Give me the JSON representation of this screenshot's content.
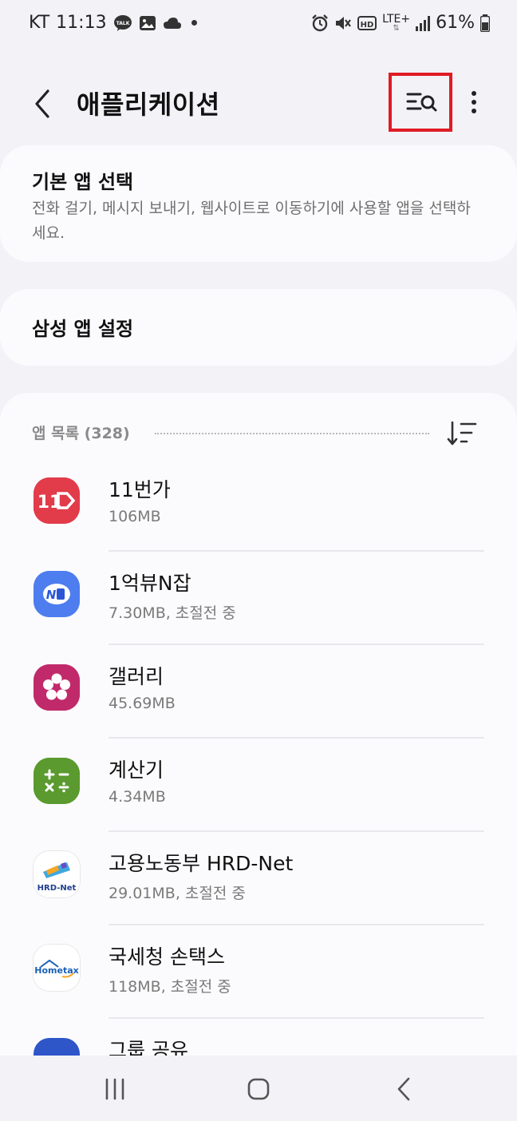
{
  "status": {
    "carrier": "KT",
    "time": "11:13",
    "talk_badge": "TALK",
    "hd_badge": "HD",
    "network": "LTE+",
    "battery": "61%"
  },
  "appbar": {
    "title": "애플리케이션"
  },
  "default_apps": {
    "title": "기본 앱 선택",
    "subtitle": "전화 걸기, 메시지 보내기, 웹사이트로 이동하기에 사용할 앱을 선택하세요."
  },
  "samsung_settings": {
    "title": "삼성 앱 설정"
  },
  "app_list": {
    "header": "앱 목록 (328)",
    "items": [
      {
        "name": "11번가",
        "size": "106MB",
        "icon": "eleven-street-icon",
        "color": "#e8363f",
        "glyph": "11▷"
      },
      {
        "name": "1억뷰N잡",
        "size": "7.30MB, 초절전 중",
        "icon": "one-billion-view-icon",
        "color": "#4e7ef0",
        "glyph": "N잡"
      },
      {
        "name": "갤러리",
        "size": "45.69MB",
        "icon": "gallery-flower-icon",
        "color": "#c4286a",
        "glyph": "✿"
      },
      {
        "name": "계산기",
        "size": "4.34MB",
        "icon": "calculator-icon",
        "color": "#5a9a2e",
        "glyph": "+−×÷"
      },
      {
        "name": "고용노동부 HRD-Net",
        "size": "29.01MB, 초절전 중",
        "icon": "hrd-net-icon",
        "color": "#ffffff",
        "glyph": "HRD-Net"
      },
      {
        "name": "국세청 손택스",
        "size": "118MB, 초절전 중",
        "icon": "hometax-icon",
        "color": "#ffffff",
        "glyph": "Hometax"
      },
      {
        "name": "그룹 공유",
        "size": "",
        "icon": "group-share-icon",
        "color": "#2e56c9",
        "glyph": ""
      }
    ]
  },
  "colors": {
    "highlight": "#e01b24",
    "background": "#f3f2f7",
    "card": "#fbfbfd"
  }
}
